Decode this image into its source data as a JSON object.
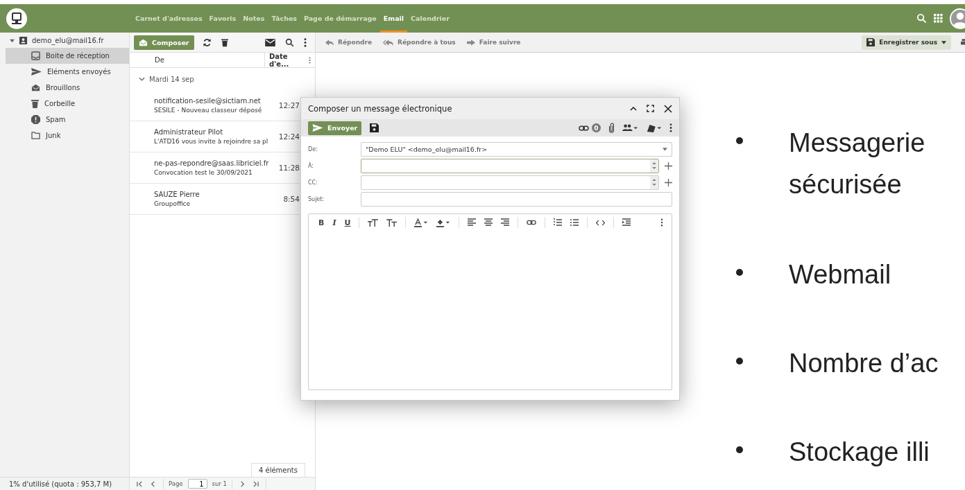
{
  "header": {
    "menu": [
      {
        "label": "Carnet d'adresses",
        "selected": false
      },
      {
        "label": "Favoris",
        "selected": false
      },
      {
        "label": "Notes",
        "selected": false
      },
      {
        "label": "Tâches",
        "selected": false
      },
      {
        "label": "Page de démarrage",
        "selected": false
      },
      {
        "label": "Email",
        "selected": true
      },
      {
        "label": "Calendrier",
        "selected": false
      }
    ]
  },
  "sidebar": {
    "account": "demo_elu@mail16.fr",
    "expanded": true,
    "folders": [
      {
        "kind": "inbox",
        "label": "Boite de réception",
        "selected": true
      },
      {
        "kind": "sent",
        "label": "Eléments envoyés",
        "selected": false
      },
      {
        "kind": "drafts",
        "label": "Brouillons",
        "selected": false
      },
      {
        "kind": "trash",
        "label": "Corbeille",
        "selected": false
      },
      {
        "kind": "spam",
        "label": "Spam",
        "selected": false
      },
      {
        "kind": "folder",
        "label": "Junk",
        "selected": false
      }
    ],
    "quota": "1% d'utilisé (quota : 953,7 M)"
  },
  "mail_list": {
    "compose_button": "Composer",
    "columns": [
      "De",
      "Date d'e..."
    ],
    "group": "Mardi 14 sep",
    "rows": [
      {
        "from": "notification-sesile@sictiam.net",
        "subject": "SESILE - Nouveau classeur déposé",
        "time": "12:27"
      },
      {
        "from": "Administrateur Pilot",
        "subject": "L'ATD16 vous invite à rejoindre sa pl",
        "time": "12:24"
      },
      {
        "from": "ne-pas-repondre@saas.libriciel.fr",
        "subject": "Convocation test le 30/09/2021",
        "time": "11:28"
      },
      {
        "from": "SAUZE Pierre",
        "subject": "Groupoffice",
        "time": "8:54"
      }
    ],
    "count": "4 éléments",
    "pagination": {
      "page_label": "Page",
      "page": "1",
      "of": "sur 1"
    }
  },
  "reading_pane": {
    "actions": [
      "Répondre",
      "Répondre à tous",
      "Faire suivre"
    ],
    "save_as": "Enregistrer sous"
  },
  "compose_dialog": {
    "title": "Composer un message électronique",
    "send": "Envoyer",
    "links_count": "0",
    "fields": [
      {
        "label": "De:",
        "value": "\"Demo ELU\" <demo_elu@mail16.fr>",
        "kind": "select"
      },
      {
        "label": "À:",
        "kind": "recipients"
      },
      {
        "label": "CC:",
        "kind": "recipients"
      },
      {
        "label": "Sujet:",
        "kind": "text"
      }
    ],
    "format": [
      "B",
      "I",
      "U"
    ]
  },
  "bullets": [
    "Messagerie sécurisée",
    "Webmail",
    "Nombre d’ac",
    "Stockage illi"
  ]
}
